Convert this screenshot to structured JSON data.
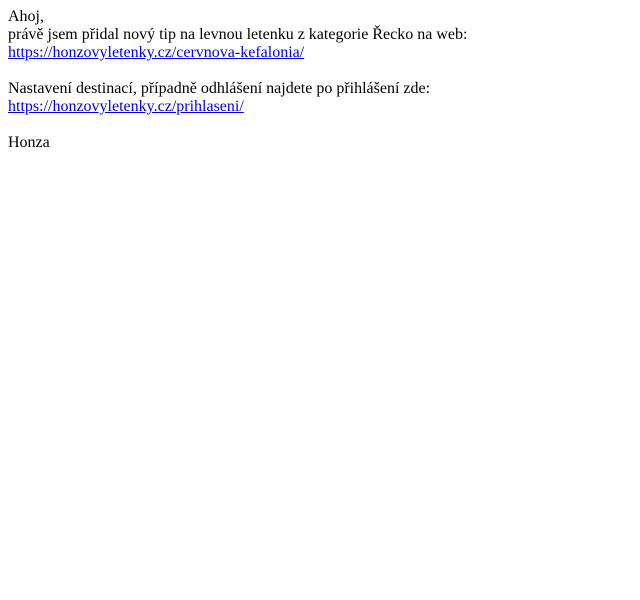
{
  "message": {
    "greeting": "Ahoj,",
    "intro": "právě jsem přidal nový tip na levnou letenku z kategorie Řecko na web:",
    "tip_link": "https://honzovyletenky.cz/cervnova-kefalonia/",
    "settings_text": "Nastavení destinací, případně odhlášení najdete po přihlášení zde:",
    "login_link": "https://honzovyletenky.cz/prihlaseni/",
    "signature": "Honza"
  },
  "colors": {
    "link": "#0000ee",
    "text": "#000000",
    "background": "#ffffff"
  }
}
